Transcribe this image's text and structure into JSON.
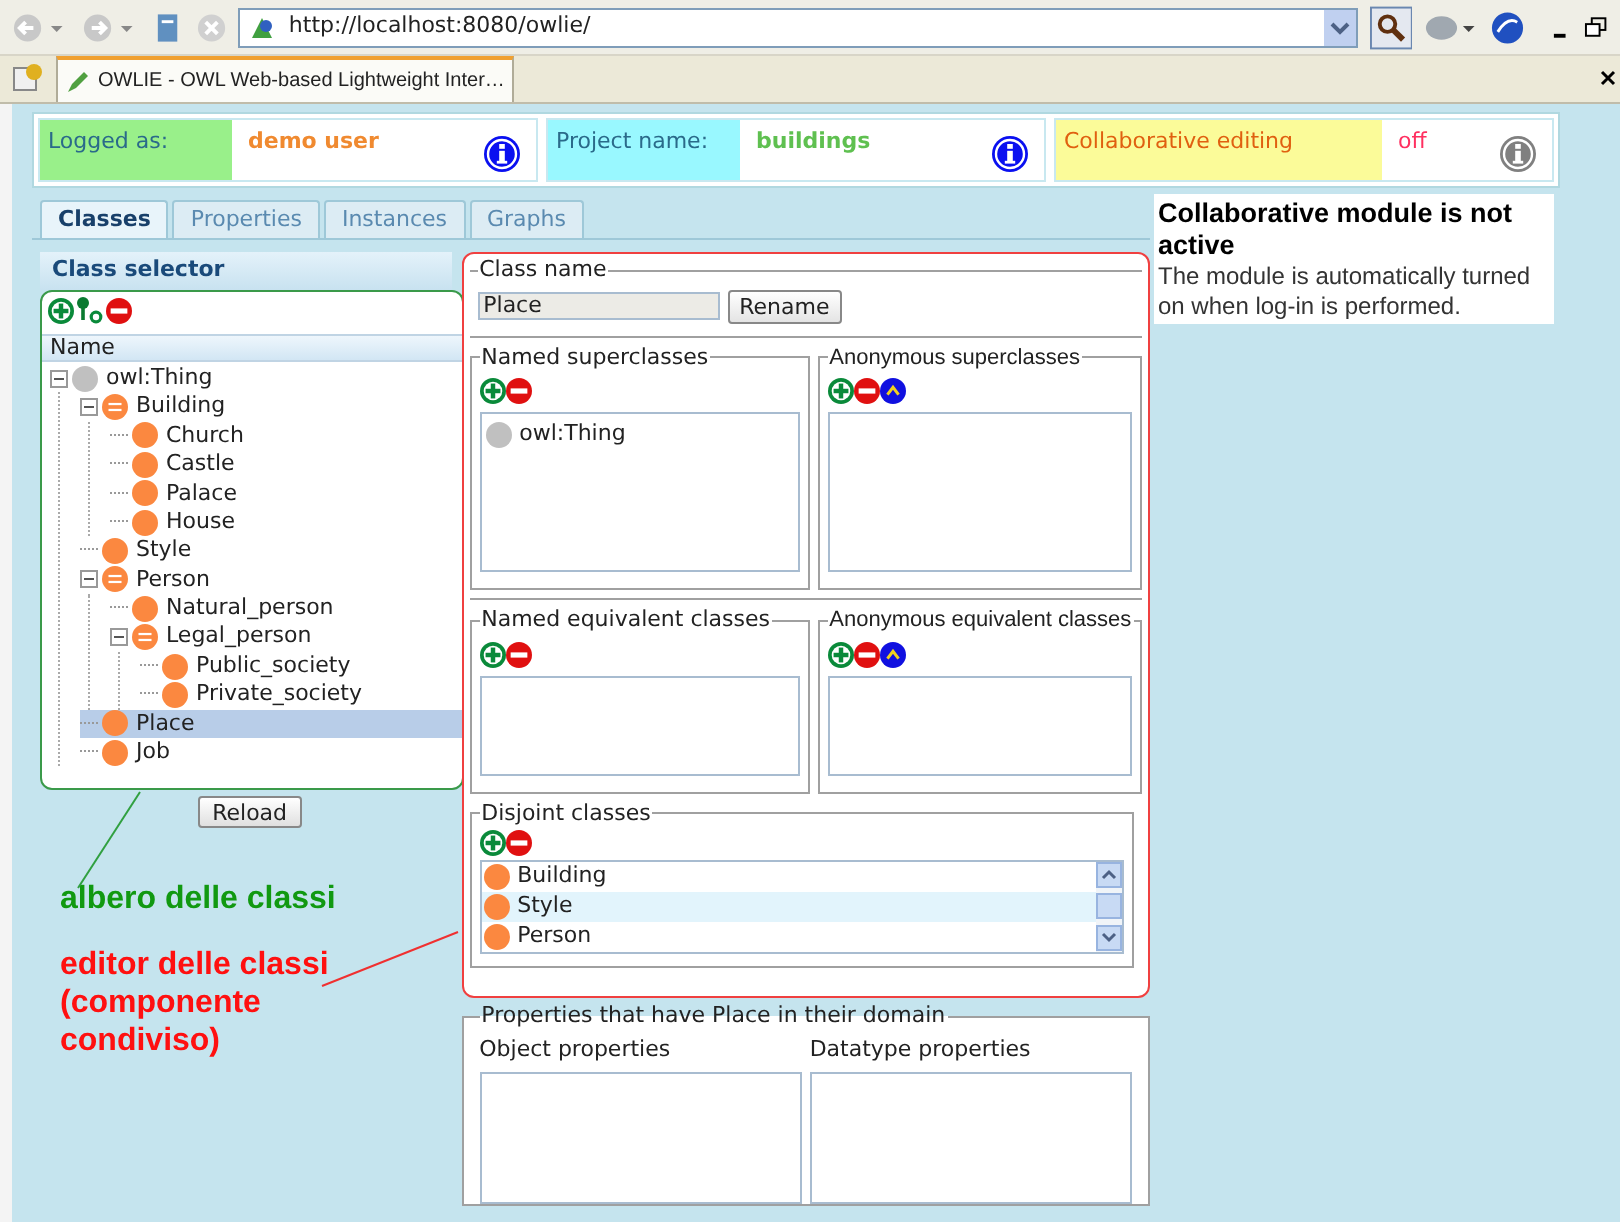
{
  "browser": {
    "address": "http://localhost:8080/owlie/",
    "tab_title": "OWLIE - OWL Web-based Lightweight Inter…"
  },
  "info_bar": [
    {
      "label": "Logged as:",
      "color": "#99f08a",
      "value": {
        "text": "demo user",
        "color": "#f08a30"
      },
      "icon_active": true
    },
    {
      "label": "Project name:",
      "color": "#99f8ff",
      "value": {
        "text": "buildings",
        "color": "#5fc050"
      },
      "icon_active": true
    },
    {
      "label": "Collaborative editing",
      "color": "#fbfb99",
      "value": {
        "text": "off",
        "color": "#ff3060"
      },
      "icon_active": false
    }
  ],
  "tabs": [
    {
      "label": "Classes",
      "selected": true
    },
    {
      "label": "Properties",
      "selected": false
    },
    {
      "label": "Instances",
      "selected": false
    },
    {
      "label": "Graphs",
      "selected": false
    }
  ],
  "class_selector": {
    "title": "Class selector",
    "column": "Name",
    "reload": "Reload",
    "tree": [
      {
        "label": "owl:Thing",
        "kind": "thing",
        "expanded": true,
        "selected": false,
        "children": [
          {
            "label": "Building",
            "kind": "class",
            "expanded": true,
            "selected": false,
            "children": [
              {
                "label": "Church",
                "kind": "class",
                "selected": false
              },
              {
                "label": "Castle",
                "kind": "class",
                "selected": false
              },
              {
                "label": "Palace",
                "kind": "class",
                "selected": false
              },
              {
                "label": "House",
                "kind": "class",
                "selected": false
              }
            ]
          },
          {
            "label": "Style",
            "kind": "class",
            "selected": false
          },
          {
            "label": "Person",
            "kind": "class",
            "expanded": true,
            "selected": false,
            "children": [
              {
                "label": "Natural_person",
                "kind": "class",
                "selected": false
              },
              {
                "label": "Legal_person",
                "kind": "class",
                "expanded": true,
                "selected": false,
                "children": [
                  {
                    "label": "Public_society",
                    "kind": "class",
                    "selected": false
                  },
                  {
                    "label": "Private_society",
                    "kind": "class",
                    "selected": false
                  }
                ]
              }
            ]
          },
          {
            "label": "Place",
            "kind": "class",
            "selected": true
          },
          {
            "label": "Job",
            "kind": "class",
            "selected": false
          }
        ]
      }
    ]
  },
  "editor": {
    "class_name": {
      "legend": "Class name",
      "value": "Place",
      "button": "Rename"
    },
    "sections": [
      {
        "legend": "Named superclasses",
        "kind": "named",
        "items": [
          {
            "label": "owl:Thing",
            "kind": "thing"
          }
        ]
      },
      {
        "legend": "Anonymous superclasses",
        "kind": "anonymous"
      },
      {
        "legend": "Named equivalent classes",
        "kind": "named"
      },
      {
        "legend": "Anonymous equivalent classes",
        "kind": "anonymous"
      }
    ],
    "disjoint": {
      "legend": "Disjoint classes",
      "items": [
        {
          "label": "Building",
          "selected": false
        },
        {
          "label": "Style",
          "selected": true
        },
        {
          "label": "Person",
          "selected": false
        }
      ]
    }
  },
  "properties": {
    "legend": "Properties that have Place in their domain",
    "columns": [
      "Object properties",
      "Datatype properties"
    ]
  },
  "notice": {
    "title": "Collaborative module is not active",
    "text": "The module is automatically turned on when log-in is performed."
  },
  "annotations": [
    {
      "text": "albero delle classi",
      "color": "#119911"
    },
    {
      "text": "editor delle classi (componente condiviso)",
      "color": "#ff1010"
    }
  ]
}
